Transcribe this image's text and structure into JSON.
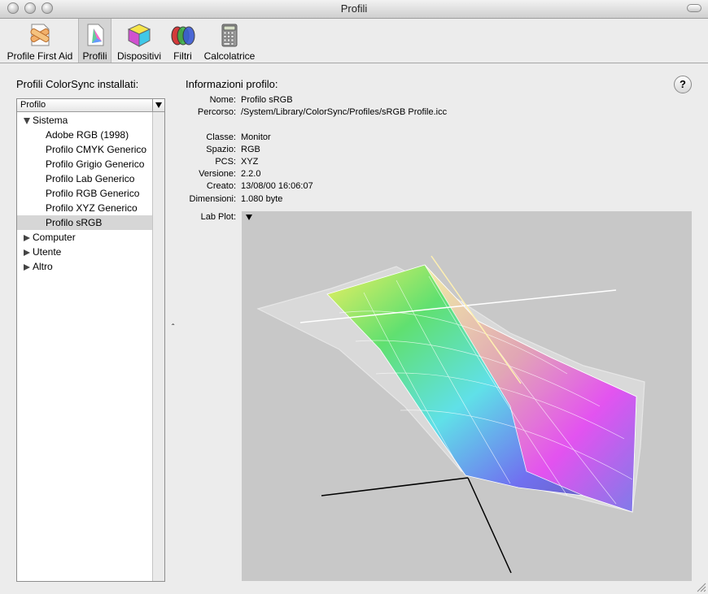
{
  "window": {
    "title": "Profili"
  },
  "toolbar": {
    "items": [
      {
        "label": "Profile First Aid",
        "icon": "first-aid-icon"
      },
      {
        "label": "Profili",
        "icon": "profile-document-icon",
        "selected": true
      },
      {
        "label": "Dispositivi",
        "icon": "devices-cube-icon"
      },
      {
        "label": "Filtri",
        "icon": "filters-icon"
      },
      {
        "label": "Calcolatrice",
        "icon": "calculator-icon"
      }
    ]
  },
  "sidebar": {
    "title": "Profili ColorSync installati:",
    "column_header": "Profilo",
    "groups": [
      {
        "label": "Sistema",
        "expanded": true,
        "items": [
          "Adobe RGB (1998)",
          "Profilo CMYK Generico",
          "Profilo Grigio Generico",
          "Profilo Lab Generico",
          "Profilo RGB Generico",
          "Profilo XYZ Generico",
          "Profilo sRGB"
        ],
        "selected_item": "Profilo sRGB"
      },
      {
        "label": "Computer",
        "expanded": false
      },
      {
        "label": "Utente",
        "expanded": false
      },
      {
        "label": "Altro",
        "expanded": false
      }
    ]
  },
  "info": {
    "title": "Informazioni profilo:",
    "fields": {
      "nome": {
        "key": "Nome:",
        "value": "Profilo sRGB"
      },
      "percorso": {
        "key": "Percorso:",
        "value": "/System/Library/ColorSync/Profiles/sRGB Profile.icc"
      },
      "classe": {
        "key": "Classe:",
        "value": "Monitor"
      },
      "spazio": {
        "key": "Spazio:",
        "value": "RGB"
      },
      "pcs": {
        "key": "PCS:",
        "value": "XYZ"
      },
      "versione": {
        "key": "Versione:",
        "value": "2.2.0"
      },
      "creato": {
        "key": "Creato:",
        "value": "13/08/00 16:06:07"
      },
      "dimensioni": {
        "key": "Dimensioni:",
        "value": "1.080 byte"
      }
    },
    "plot_label": "Lab Plot:",
    "help_label": "?"
  },
  "colors": {
    "plot_background": "#c8c8c8",
    "selection": "#d6d6d6"
  }
}
